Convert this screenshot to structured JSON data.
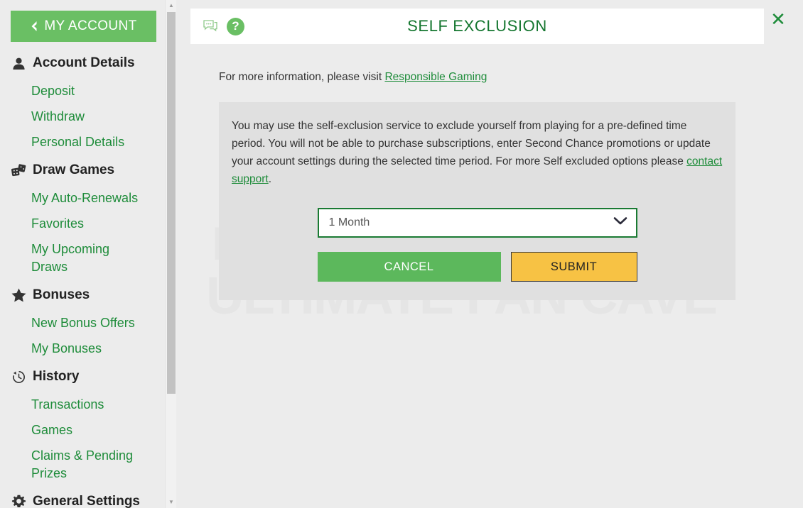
{
  "colors": {
    "brand_green": "#6abf64",
    "link_green": "#1e8c3a",
    "title_green": "#14762f",
    "submit_amber": "#f7c244",
    "cancel_green": "#5cb85c",
    "panel_gray": "#e0e0e0",
    "page_gray": "#ececec"
  },
  "sidebar": {
    "my_account_label": "MY ACCOUNT",
    "back_icon": "chevron-left-icon",
    "groups": [
      {
        "title": "Account Details",
        "icon": "user-icon",
        "links": [
          "Deposit",
          "Withdraw",
          "Personal Details"
        ]
      },
      {
        "title": "Draw Games",
        "icon": "dice-icon",
        "links": [
          "My Auto-Renewals",
          "Favorites",
          "My Upcoming Draws"
        ]
      },
      {
        "title": "Bonuses",
        "icon": "star-icon",
        "links": [
          "New Bonus Offers",
          "My Bonuses"
        ]
      },
      {
        "title": "History",
        "icon": "clock-history-icon",
        "links": [
          "Transactions",
          "Games",
          "Claims & Pending Prizes"
        ]
      },
      {
        "title": "General Settings",
        "icon": "gear-icon",
        "links": []
      }
    ],
    "scrollbar": {
      "up_arrow": "▲",
      "down_arrow": "▼"
    }
  },
  "modal": {
    "title": "SELF EXCLUSION",
    "chat_icon": "chat-bubble-icon",
    "help_icon": "question-mark-icon",
    "help_glyph": "?",
    "close_icon": "close-x-icon",
    "close_glyph": "✕",
    "info_prefix": "For more information, please visit ",
    "info_link": "Responsible Gaming",
    "panel_text_1": "You may use the self-exclusion service to exclude yourself from playing for a pre-defined time period. You will not be able to purchase subscriptions, enter Second Chance promotions or update your account settings during the selected time period. For more Self excluded options please ",
    "panel_link": "contact support",
    "panel_text_2": ".",
    "select": {
      "value": "1 Month",
      "chevron_icon": "chevron-down-icon"
    },
    "buttons": {
      "cancel": "CANCEL",
      "submit": "SUBMIT"
    }
  },
  "background": {
    "watermark_line_1": "ENTER          THE",
    "watermark_line_2": "ULTIMATE FAN CAVE"
  }
}
